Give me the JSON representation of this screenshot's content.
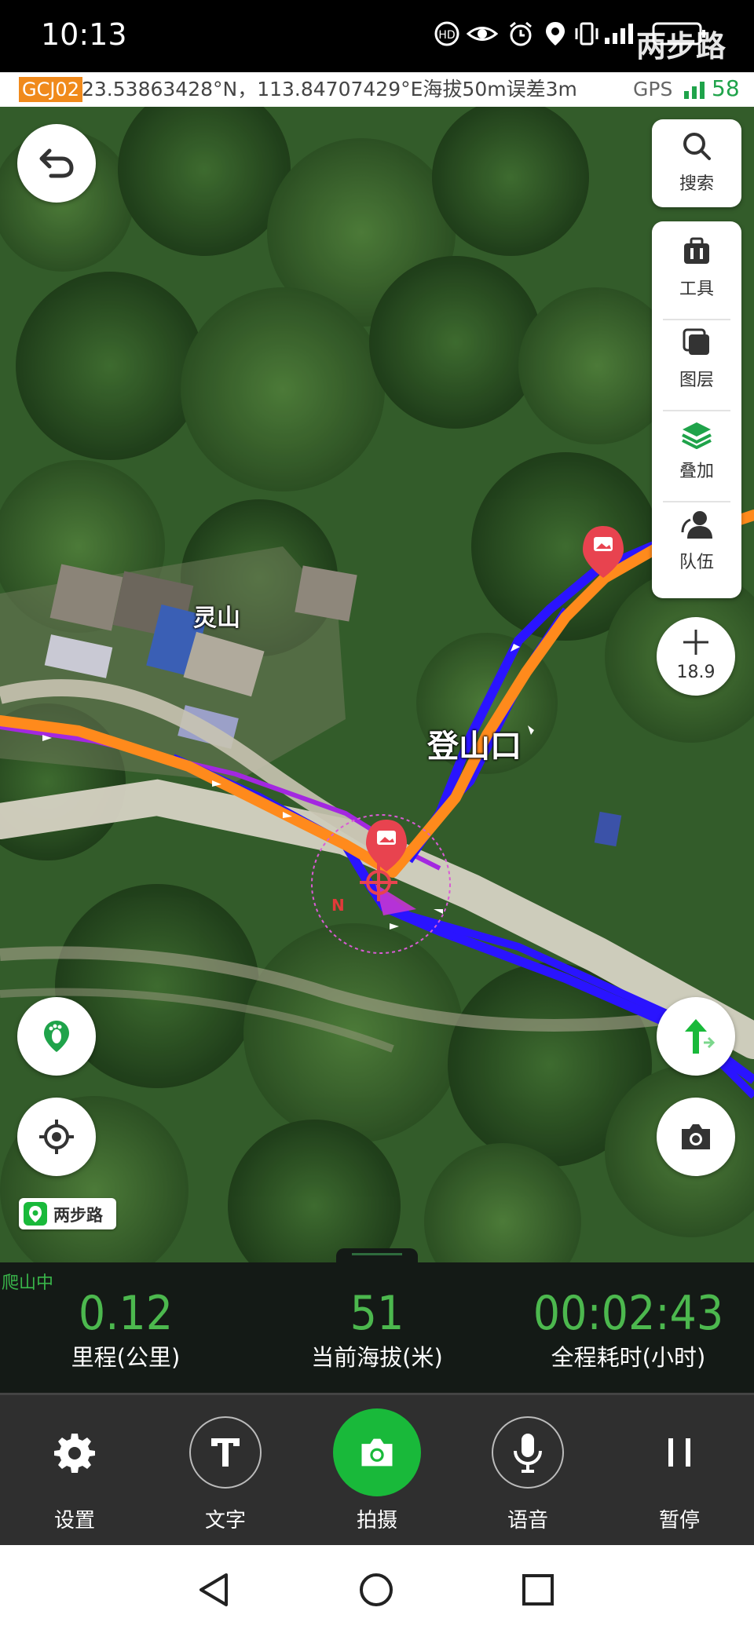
{
  "status_bar": {
    "time": "10:13",
    "icons": [
      "hd-call-icon",
      "eye-icon",
      "alarm-icon",
      "location-icon",
      "vibrate-icon",
      "signal-icon",
      "battery-icon"
    ],
    "watermark": "两步路"
  },
  "coord_bar": {
    "datum": "GCJ02",
    "coordinates": "23.53863428°N，113.84707429°E海拔50m误差3m",
    "gps_label": "GPS",
    "gps_satellites": "58"
  },
  "map": {
    "place_label": "灵山",
    "waypoint_label": "登山口",
    "compass_letter": "N",
    "search": {
      "label": "搜索",
      "icon": "search-icon"
    },
    "tools": [
      {
        "label": "工具",
        "icon": "toolbox-icon"
      },
      {
        "label": "图层",
        "icon": "layers-icon"
      },
      {
        "label": "叠加",
        "icon": "overlay-icon"
      },
      {
        "label": "队伍",
        "icon": "team-icon"
      }
    ],
    "zoom_level": "18.9",
    "brand": "两步路",
    "colors": {
      "track_orange": "#ff8a1c",
      "track_blue": "#2a14ff",
      "track_purple": "#a328e0",
      "marker_red": "#e8434f"
    }
  },
  "stats": {
    "status": "爬山中",
    "items": [
      {
        "value": "0.12",
        "label": "里程(公里)"
      },
      {
        "value": "51",
        "label": "当前海拔(米)"
      },
      {
        "value": "00:02:43",
        "label": "全程耗时(小时)"
      }
    ],
    "accent_color": "#4cb84e"
  },
  "toolbar": {
    "items": [
      {
        "label": "设置",
        "icon": "gear-icon"
      },
      {
        "label": "文字",
        "icon": "text-icon"
      },
      {
        "label": "拍摄",
        "icon": "camera-icon"
      },
      {
        "label": "语音",
        "icon": "microphone-icon"
      },
      {
        "label": "暂停",
        "icon": "pause-icon"
      }
    ],
    "accent_color": "#19b93a"
  },
  "nav_bar": {
    "buttons": [
      "back-icon",
      "home-icon",
      "recents-icon"
    ]
  }
}
